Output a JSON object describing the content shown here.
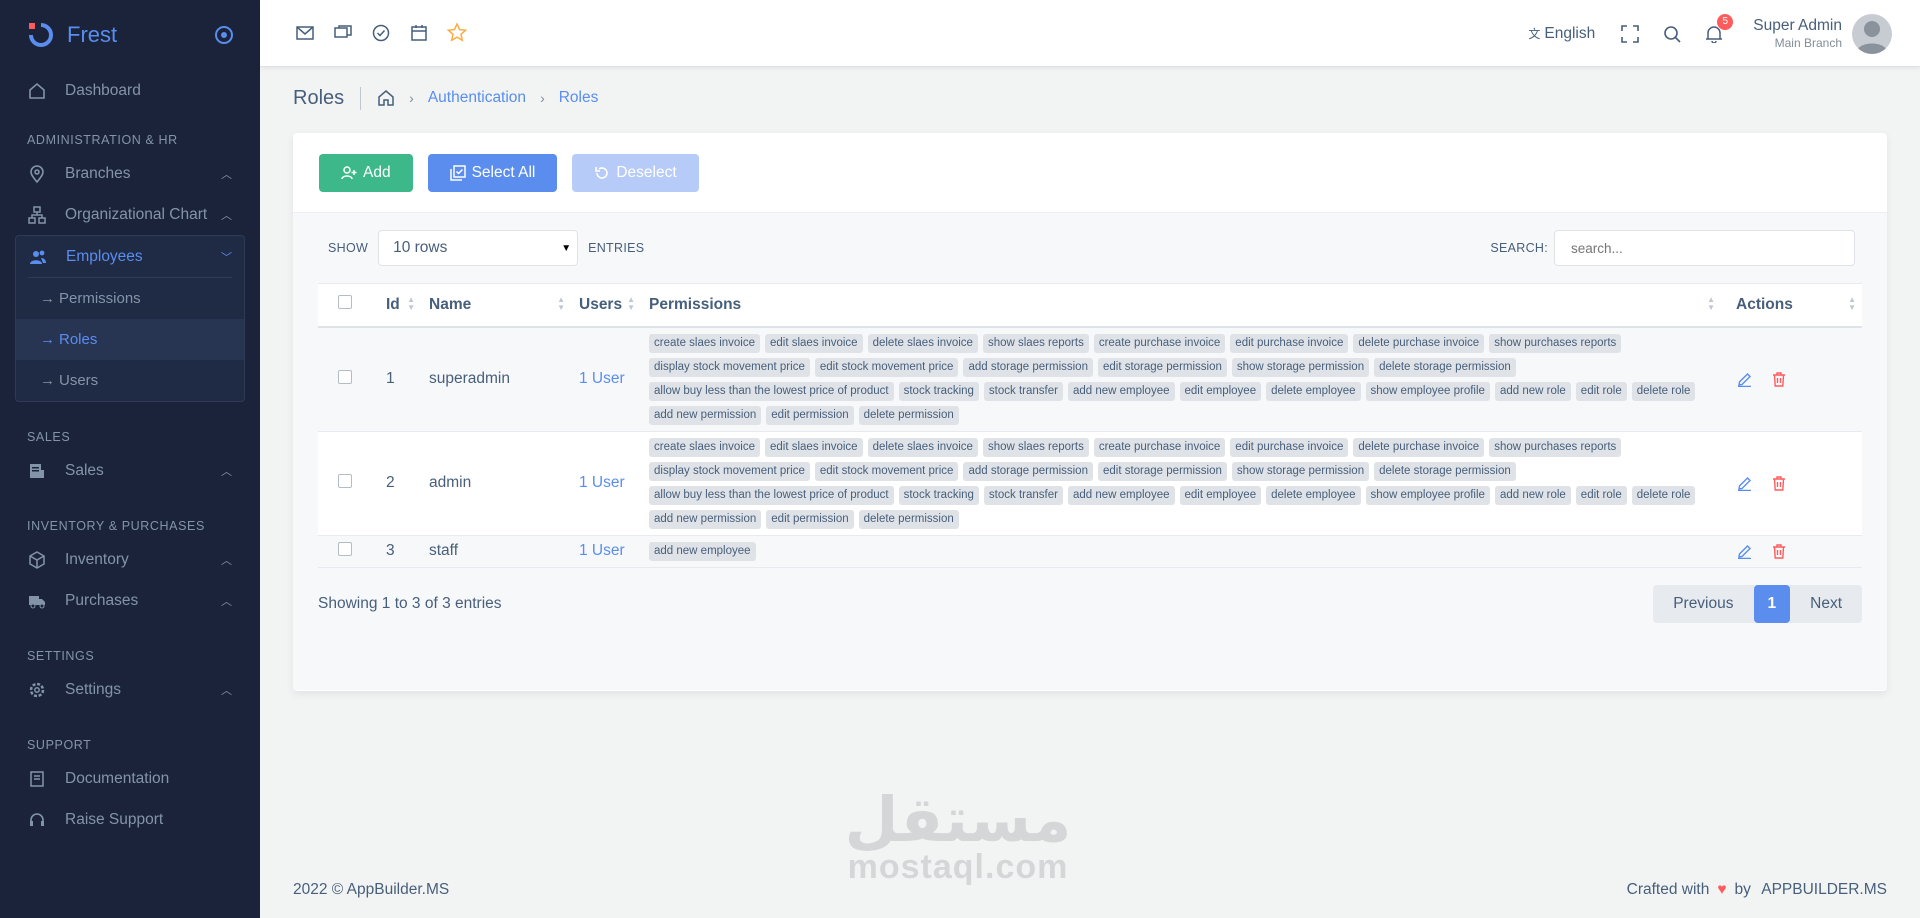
{
  "brand": {
    "name": "Frest"
  },
  "sidebar": {
    "dashboard": "Dashboard",
    "sections": {
      "admin_hr": "ADMINISTRATION & HR",
      "sales": "SALES",
      "inventory_purchases": "INVENTORY & PURCHASES",
      "settings": "SETTINGS",
      "support": "SUPPORT"
    },
    "branches": "Branches",
    "org_chart": "Organizational Chart",
    "employees": "Employees",
    "employee_sub": [
      "Permissions",
      "Roles",
      "Users"
    ],
    "sales": "Sales",
    "inventory": "Inventory",
    "purchases": "Purchases",
    "settings": "Settings",
    "documentation": "Documentation",
    "raise_support": "Raise Support"
  },
  "topbar": {
    "language": "English",
    "notifications_count": "5",
    "user_name": "Super Admin",
    "user_branch": "Main Branch"
  },
  "breadcrumb": {
    "page_title": "Roles",
    "items": [
      "Authentication",
      "Roles"
    ]
  },
  "toolbar": {
    "add": "Add",
    "select_all": "Select All",
    "deselect": "Deselect"
  },
  "filters": {
    "show": "SHOW",
    "rows_selected": "10 rows",
    "entries": "ENTRIES",
    "search_label": "SEARCH:",
    "search_placeholder": "search..."
  },
  "table": {
    "headers": [
      "Id",
      "Name",
      "Users",
      "Permissions",
      "Actions"
    ],
    "rows": [
      {
        "id": "1",
        "name": "superadmin",
        "users": "1 User",
        "permissions": [
          "create slaes invoice",
          "edit slaes invoice",
          "delete slaes invoice",
          "show slaes reports",
          "create purchase invoice",
          "edit purchase invoice",
          "delete purchase invoice",
          "show purchases reports",
          "display stock movement price",
          "edit stock movement price",
          "add storage permission",
          "edit storage permission",
          "show storage permission",
          "delete storage permission",
          "allow buy less than the lowest price of product",
          "stock tracking",
          "stock transfer",
          "add new employee",
          "edit employee",
          "delete employee",
          "show employee profile",
          "add new role",
          "edit role",
          "delete role",
          "add new permission",
          "edit permission",
          "delete permission"
        ]
      },
      {
        "id": "2",
        "name": "admin",
        "users": "1 User",
        "permissions": [
          "create slaes invoice",
          "edit slaes invoice",
          "delete slaes invoice",
          "show slaes reports",
          "create purchase invoice",
          "edit purchase invoice",
          "delete purchase invoice",
          "show purchases reports",
          "display stock movement price",
          "edit stock movement price",
          "add storage permission",
          "edit storage permission",
          "show storage permission",
          "delete storage permission",
          "allow buy less than the lowest price of product",
          "stock tracking",
          "stock transfer",
          "add new employee",
          "edit employee",
          "delete employee",
          "show employee profile",
          "add new role",
          "edit role",
          "delete role",
          "add new permission",
          "edit permission",
          "delete permission"
        ]
      },
      {
        "id": "3",
        "name": "staff",
        "users": "1 User",
        "permissions": [
          "add new employee"
        ]
      }
    ]
  },
  "pagination": {
    "info": "Showing 1 to 3 of 3 entries",
    "previous": "Previous",
    "current": "1",
    "next": "Next"
  },
  "watermark": {
    "arabic": "مستقل",
    "latin": "mostaql.com"
  },
  "footer": {
    "copyright": "2022 © AppBuilder.MS",
    "crafted": "Crafted with",
    "by": "by",
    "company": "APPBUILDER.MS"
  },
  "colors": {
    "primary": "#5a8dee",
    "success": "#3cb88a",
    "danger": "#ff5b5c",
    "sidebar_bg": "#1a233a"
  }
}
